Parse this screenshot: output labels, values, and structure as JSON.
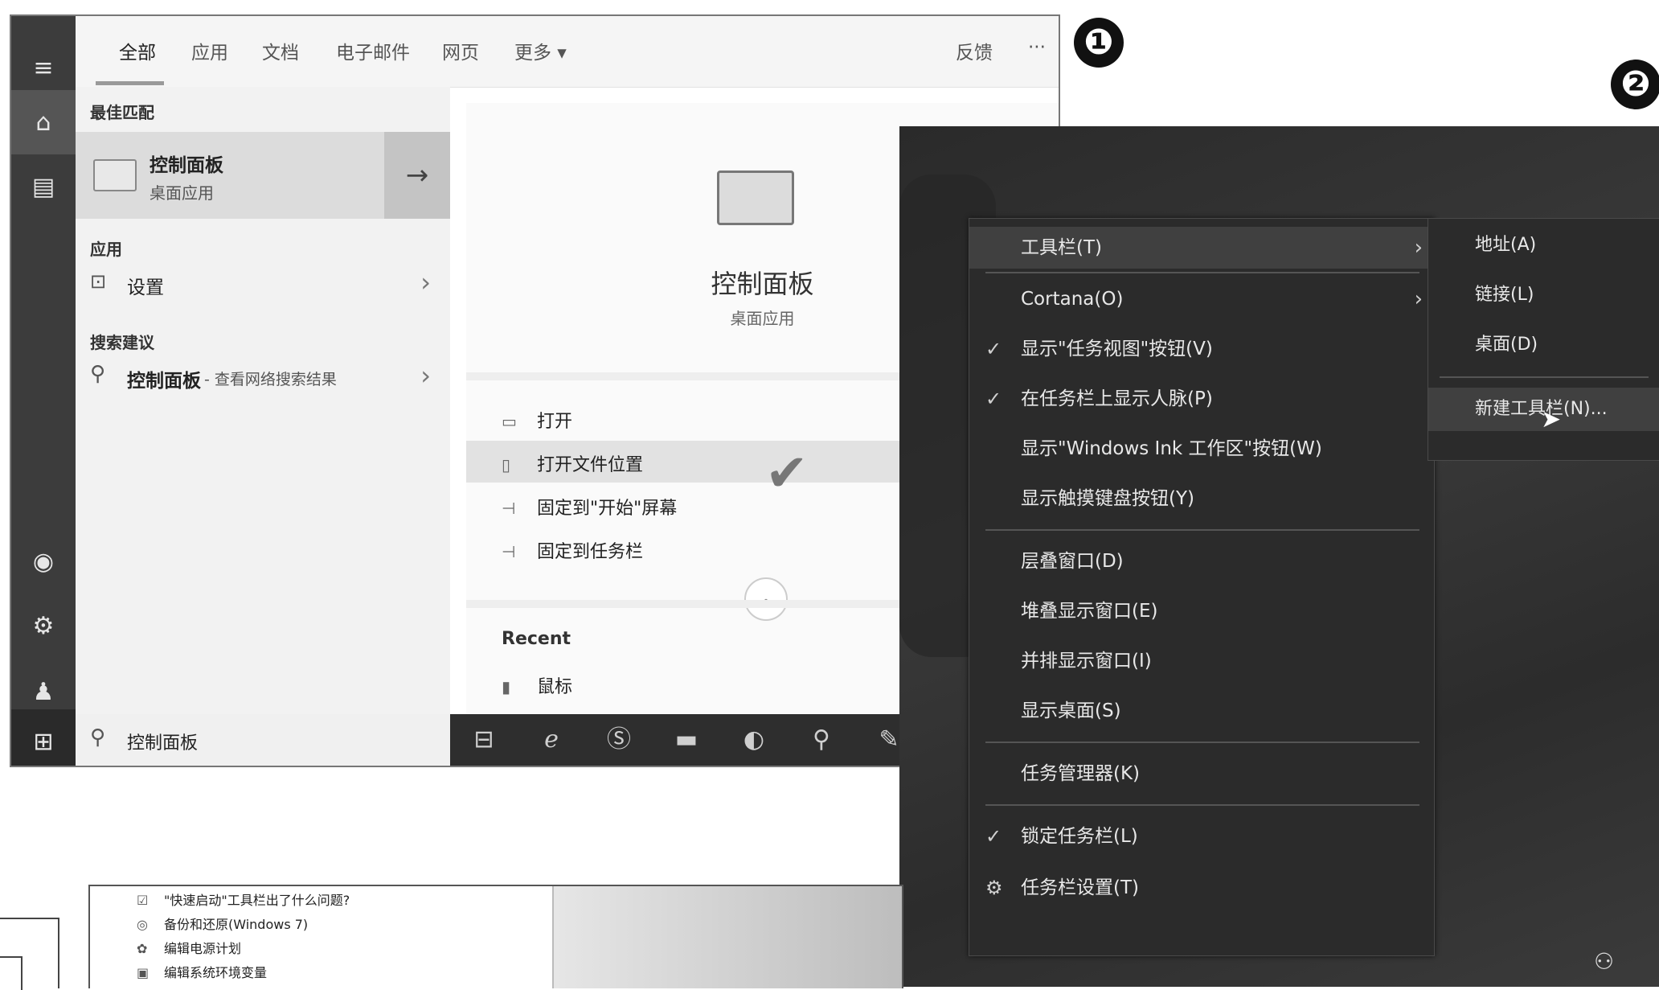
{
  "markers": {
    "m1": "❶",
    "m2": "❷"
  },
  "search": {
    "tabs": [
      "全部",
      "应用",
      "文档",
      "电子邮件",
      "网页",
      "更多 ▾"
    ],
    "feedback": "反馈",
    "more_dots": "···",
    "best_match_header": "最佳匹配",
    "best_match": {
      "title": "控制面板",
      "subtitle": "桌面应用"
    },
    "apps_header": "应用",
    "apps": [
      {
        "label": "设置"
      }
    ],
    "suggest_header": "搜索建议",
    "suggestion": {
      "label": "控制面板",
      "hint": " - 查看网络搜索结果"
    },
    "detail": {
      "title": "控制面板",
      "subtitle": "桌面应用"
    },
    "actions": [
      {
        "label": "打开",
        "icon": "open-icon"
      },
      {
        "label": "打开文件位置",
        "icon": "folder-open-icon"
      },
      {
        "label": "固定到\"开始\"屏幕",
        "icon": "pin-icon"
      },
      {
        "label": "固定到任务栏",
        "icon": "pin-icon"
      }
    ],
    "recent_header": "Recent",
    "recent": [
      {
        "label": "鼠标"
      }
    ],
    "search_box_value": "控制面板"
  },
  "context_menu": {
    "items": [
      {
        "label": "工具栏(T)",
        "checked": false,
        "submenu": true
      },
      {
        "label": "Cortana(O)",
        "checked": false,
        "submenu": true
      },
      {
        "label": "显示\"任务视图\"按钮(V)",
        "checked": true
      },
      {
        "label": "在任务栏上显示人脉(P)",
        "checked": true
      },
      {
        "label": "显示\"Windows Ink 工作区\"按钮(W)",
        "checked": false
      },
      {
        "label": "显示触摸键盘按钮(Y)",
        "checked": false
      },
      {
        "label": "层叠窗口(D)",
        "checked": false
      },
      {
        "label": "堆叠显示窗口(E)",
        "checked": false
      },
      {
        "label": "并排显示窗口(I)",
        "checked": false
      },
      {
        "label": "显示桌面(S)",
        "checked": false
      },
      {
        "label": "任务管理器(K)",
        "checked": false
      },
      {
        "label": "锁定任务栏(L)",
        "checked": true
      },
      {
        "label": "任务栏设置(T)",
        "checked": false
      }
    ],
    "submenu": [
      "地址(A)",
      "链接(L)",
      "桌面(D)",
      "新建工具栏(N)..."
    ]
  },
  "control_panel_list": [
    "\"快速启动\"工具栏出了什么问题?",
    "备份和还原(Windows 7)",
    "编辑电源计划",
    "编辑系统环境变量"
  ]
}
